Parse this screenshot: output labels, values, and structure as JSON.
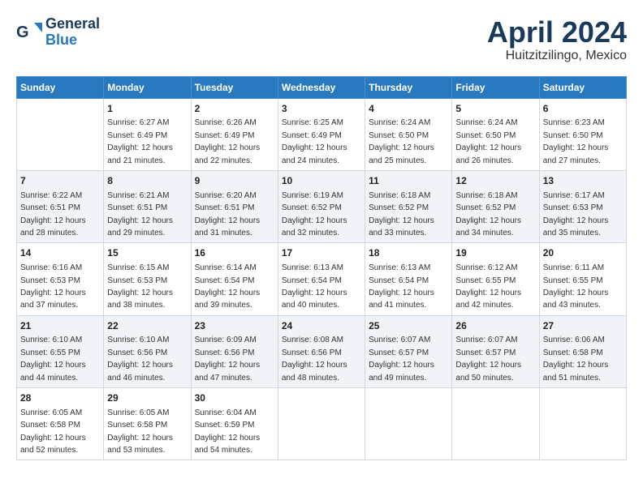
{
  "logo": {
    "line1": "General",
    "line2": "Blue"
  },
  "title": "April 2024",
  "subtitle": "Huitzitzilingo, Mexico",
  "headers": [
    "Sunday",
    "Monday",
    "Tuesday",
    "Wednesday",
    "Thursday",
    "Friday",
    "Saturday"
  ],
  "weeks": [
    [
      {
        "day": "",
        "sunrise": "",
        "sunset": "",
        "daylight": ""
      },
      {
        "day": "1",
        "sunrise": "Sunrise: 6:27 AM",
        "sunset": "Sunset: 6:49 PM",
        "daylight": "Daylight: 12 hours and 21 minutes."
      },
      {
        "day": "2",
        "sunrise": "Sunrise: 6:26 AM",
        "sunset": "Sunset: 6:49 PM",
        "daylight": "Daylight: 12 hours and 22 minutes."
      },
      {
        "day": "3",
        "sunrise": "Sunrise: 6:25 AM",
        "sunset": "Sunset: 6:49 PM",
        "daylight": "Daylight: 12 hours and 24 minutes."
      },
      {
        "day": "4",
        "sunrise": "Sunrise: 6:24 AM",
        "sunset": "Sunset: 6:50 PM",
        "daylight": "Daylight: 12 hours and 25 minutes."
      },
      {
        "day": "5",
        "sunrise": "Sunrise: 6:24 AM",
        "sunset": "Sunset: 6:50 PM",
        "daylight": "Daylight: 12 hours and 26 minutes."
      },
      {
        "day": "6",
        "sunrise": "Sunrise: 6:23 AM",
        "sunset": "Sunset: 6:50 PM",
        "daylight": "Daylight: 12 hours and 27 minutes."
      }
    ],
    [
      {
        "day": "7",
        "sunrise": "Sunrise: 6:22 AM",
        "sunset": "Sunset: 6:51 PM",
        "daylight": "Daylight: 12 hours and 28 minutes."
      },
      {
        "day": "8",
        "sunrise": "Sunrise: 6:21 AM",
        "sunset": "Sunset: 6:51 PM",
        "daylight": "Daylight: 12 hours and 29 minutes."
      },
      {
        "day": "9",
        "sunrise": "Sunrise: 6:20 AM",
        "sunset": "Sunset: 6:51 PM",
        "daylight": "Daylight: 12 hours and 31 minutes."
      },
      {
        "day": "10",
        "sunrise": "Sunrise: 6:19 AM",
        "sunset": "Sunset: 6:52 PM",
        "daylight": "Daylight: 12 hours and 32 minutes."
      },
      {
        "day": "11",
        "sunrise": "Sunrise: 6:18 AM",
        "sunset": "Sunset: 6:52 PM",
        "daylight": "Daylight: 12 hours and 33 minutes."
      },
      {
        "day": "12",
        "sunrise": "Sunrise: 6:18 AM",
        "sunset": "Sunset: 6:52 PM",
        "daylight": "Daylight: 12 hours and 34 minutes."
      },
      {
        "day": "13",
        "sunrise": "Sunrise: 6:17 AM",
        "sunset": "Sunset: 6:53 PM",
        "daylight": "Daylight: 12 hours and 35 minutes."
      }
    ],
    [
      {
        "day": "14",
        "sunrise": "Sunrise: 6:16 AM",
        "sunset": "Sunset: 6:53 PM",
        "daylight": "Daylight: 12 hours and 37 minutes."
      },
      {
        "day": "15",
        "sunrise": "Sunrise: 6:15 AM",
        "sunset": "Sunset: 6:53 PM",
        "daylight": "Daylight: 12 hours and 38 minutes."
      },
      {
        "day": "16",
        "sunrise": "Sunrise: 6:14 AM",
        "sunset": "Sunset: 6:54 PM",
        "daylight": "Daylight: 12 hours and 39 minutes."
      },
      {
        "day": "17",
        "sunrise": "Sunrise: 6:13 AM",
        "sunset": "Sunset: 6:54 PM",
        "daylight": "Daylight: 12 hours and 40 minutes."
      },
      {
        "day": "18",
        "sunrise": "Sunrise: 6:13 AM",
        "sunset": "Sunset: 6:54 PM",
        "daylight": "Daylight: 12 hours and 41 minutes."
      },
      {
        "day": "19",
        "sunrise": "Sunrise: 6:12 AM",
        "sunset": "Sunset: 6:55 PM",
        "daylight": "Daylight: 12 hours and 42 minutes."
      },
      {
        "day": "20",
        "sunrise": "Sunrise: 6:11 AM",
        "sunset": "Sunset: 6:55 PM",
        "daylight": "Daylight: 12 hours and 43 minutes."
      }
    ],
    [
      {
        "day": "21",
        "sunrise": "Sunrise: 6:10 AM",
        "sunset": "Sunset: 6:55 PM",
        "daylight": "Daylight: 12 hours and 44 minutes."
      },
      {
        "day": "22",
        "sunrise": "Sunrise: 6:10 AM",
        "sunset": "Sunset: 6:56 PM",
        "daylight": "Daylight: 12 hours and 46 minutes."
      },
      {
        "day": "23",
        "sunrise": "Sunrise: 6:09 AM",
        "sunset": "Sunset: 6:56 PM",
        "daylight": "Daylight: 12 hours and 47 minutes."
      },
      {
        "day": "24",
        "sunrise": "Sunrise: 6:08 AM",
        "sunset": "Sunset: 6:56 PM",
        "daylight": "Daylight: 12 hours and 48 minutes."
      },
      {
        "day": "25",
        "sunrise": "Sunrise: 6:07 AM",
        "sunset": "Sunset: 6:57 PM",
        "daylight": "Daylight: 12 hours and 49 minutes."
      },
      {
        "day": "26",
        "sunrise": "Sunrise: 6:07 AM",
        "sunset": "Sunset: 6:57 PM",
        "daylight": "Daylight: 12 hours and 50 minutes."
      },
      {
        "day": "27",
        "sunrise": "Sunrise: 6:06 AM",
        "sunset": "Sunset: 6:58 PM",
        "daylight": "Daylight: 12 hours and 51 minutes."
      }
    ],
    [
      {
        "day": "28",
        "sunrise": "Sunrise: 6:05 AM",
        "sunset": "Sunset: 6:58 PM",
        "daylight": "Daylight: 12 hours and 52 minutes."
      },
      {
        "day": "29",
        "sunrise": "Sunrise: 6:05 AM",
        "sunset": "Sunset: 6:58 PM",
        "daylight": "Daylight: 12 hours and 53 minutes."
      },
      {
        "day": "30",
        "sunrise": "Sunrise: 6:04 AM",
        "sunset": "Sunset: 6:59 PM",
        "daylight": "Daylight: 12 hours and 54 minutes."
      },
      {
        "day": "",
        "sunrise": "",
        "sunset": "",
        "daylight": ""
      },
      {
        "day": "",
        "sunrise": "",
        "sunset": "",
        "daylight": ""
      },
      {
        "day": "",
        "sunrise": "",
        "sunset": "",
        "daylight": ""
      },
      {
        "day": "",
        "sunrise": "",
        "sunset": "",
        "daylight": ""
      }
    ]
  ]
}
